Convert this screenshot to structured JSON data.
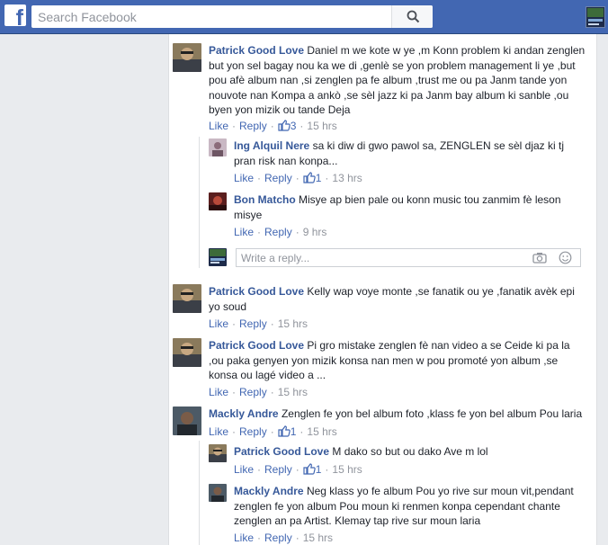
{
  "search": {
    "placeholder": "Search Facebook"
  },
  "labels": {
    "like": "Like",
    "reply": "Reply",
    "write_reply_placeholder": "Write a reply..."
  },
  "comments": [
    {
      "author": "Patrick Good Love",
      "text": "Daniel m we kote w ye ,m Konn problem ki andan zenglen but yon sel bagay nou ka we di ,genlè se yon problem management li ye ,but pou afè album nan ,si zenglen pa fe album ,trust me ou pa Janm tande yon nouvote nan Kompa a ankò ,se sèl jazz ki pa Janm bay album ki sanble ,ou byen yon mizik ou tande Deja",
      "likes": "3",
      "time": "15 hrs",
      "replies": [
        {
          "author": "Ing Alquil Nere",
          "text": "sa ki diw di gwo pawol sa, ZENGLEN se sèl djaz ki tj pran risk nan konpa...",
          "likes": "1",
          "time": "13 hrs"
        },
        {
          "author": "Bon Matcho",
          "text": "Misye ap bien pale ou konn music tou zanmim fè leson misye",
          "likes": "",
          "time": "9 hrs"
        }
      ]
    },
    {
      "author": "Patrick Good Love",
      "text": "Kelly wap voye monte ,se fanatik ou ye ,fanatik avèk epi yo soud",
      "likes": "",
      "time": "15 hrs"
    },
    {
      "author": "Patrick Good Love",
      "text": "Pi gro mistake zenglen fè nan video a se Ceide ki pa la ,ou paka genyen yon mizik konsa nan men w pou promoté yon album ,se konsa ou lagé video a ...",
      "likes": "",
      "time": "15 hrs"
    },
    {
      "author": "Mackly Andre",
      "text": "Zenglen fe yon bel album foto ,klass fe yon bel album Pou laria",
      "likes": "1",
      "time": "15 hrs",
      "replies": [
        {
          "author": "Patrick Good Love",
          "text": "M dako so but ou dako Ave m lol",
          "likes": "1",
          "time": "15 hrs"
        },
        {
          "author": "Mackly Andre",
          "text": "Neg klass yo fe album Pou yo rive sur moun vit,pendant zenglen fe yon album Pou moun ki renmen konpa cependant chante zenglen an pa Artist. Klemay tap rive sur moun laria",
          "likes": "",
          "time": "15 hrs"
        }
      ]
    }
  ],
  "colors": {
    "topbar": "#4267b2",
    "author_link": "#365899",
    "action_link": "#4267b2",
    "meta": "#90949c"
  }
}
